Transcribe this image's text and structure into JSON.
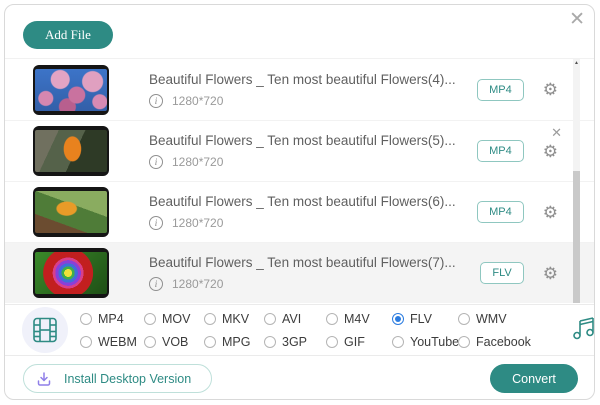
{
  "dialog": {
    "close_icon": "✕"
  },
  "toolbar": {
    "add_file_label": "Add File"
  },
  "icons": {
    "info": "i",
    "gear": "⚙",
    "row_close": "✕",
    "scroll_up": "▲"
  },
  "files": [
    {
      "title": "Beautiful Flowers _ Ten most beautiful Flowers(4)...",
      "resolution": "1280*720",
      "format": "MP4"
    },
    {
      "title": "Beautiful Flowers _ Ten most beautiful Flowers(5)...",
      "resolution": "1280*720",
      "format": "MP4"
    },
    {
      "title": "Beautiful Flowers _ Ten most beautiful Flowers(6)...",
      "resolution": "1280*720",
      "format": "MP4"
    },
    {
      "title": "Beautiful Flowers _ Ten most beautiful Flowers(7)...",
      "resolution": "1280*720",
      "format": "FLV"
    }
  ],
  "format_bar": {
    "selected": "FLV",
    "row1": [
      "MP4",
      "MOV",
      "MKV",
      "AVI",
      "M4V",
      "FLV",
      "WMV"
    ],
    "row2": [
      "WEBM",
      "VOB",
      "MPG",
      "3GP",
      "GIF",
      "YouTube",
      "Facebook"
    ]
  },
  "footer": {
    "install_label": "Install Desktop Version",
    "convert_label": "Convert"
  },
  "colors": {
    "teal": "#2e8b84",
    "radio_selected": "#2b7ce0",
    "selected_row_bg": "#f4f4f4"
  }
}
